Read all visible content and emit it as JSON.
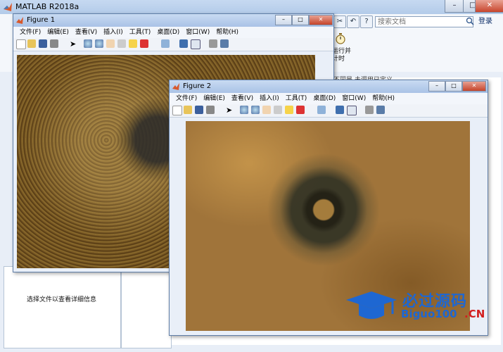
{
  "main_window": {
    "title": "MATLAB R2018a",
    "search_placeholder": "搜索文档",
    "login_label": "登录",
    "timer_label": "运行并计时",
    "details_text": "选择文件以查看详细信息",
    "right_text": "不同是 未调用已定义",
    "help_glyph": "?",
    "minimize_glyph": "–",
    "maximize_glyph": "□",
    "close_glyph": "✕"
  },
  "figure1": {
    "title": "Figure 1",
    "menu": [
      "文件(F)",
      "编辑(E)",
      "查看(V)",
      "插入(I)",
      "工具(T)",
      "桌面(D)",
      "窗口(W)",
      "帮助(H)"
    ]
  },
  "figure2": {
    "title": "Figure 2",
    "menu": [
      "文件(F)",
      "编辑(E)",
      "查看(V)",
      "插入(I)",
      "工具(T)",
      "桌面(D)",
      "窗口(W)",
      "帮助(H)"
    ]
  },
  "watermark": {
    "line1": "必过源码",
    "line2": "Biguo100",
    "suffix": ".CN"
  },
  "colors": {
    "titlebar": "#b3cbe9",
    "accent": "#1e67d2",
    "watermark_red": "#d21e1e"
  }
}
